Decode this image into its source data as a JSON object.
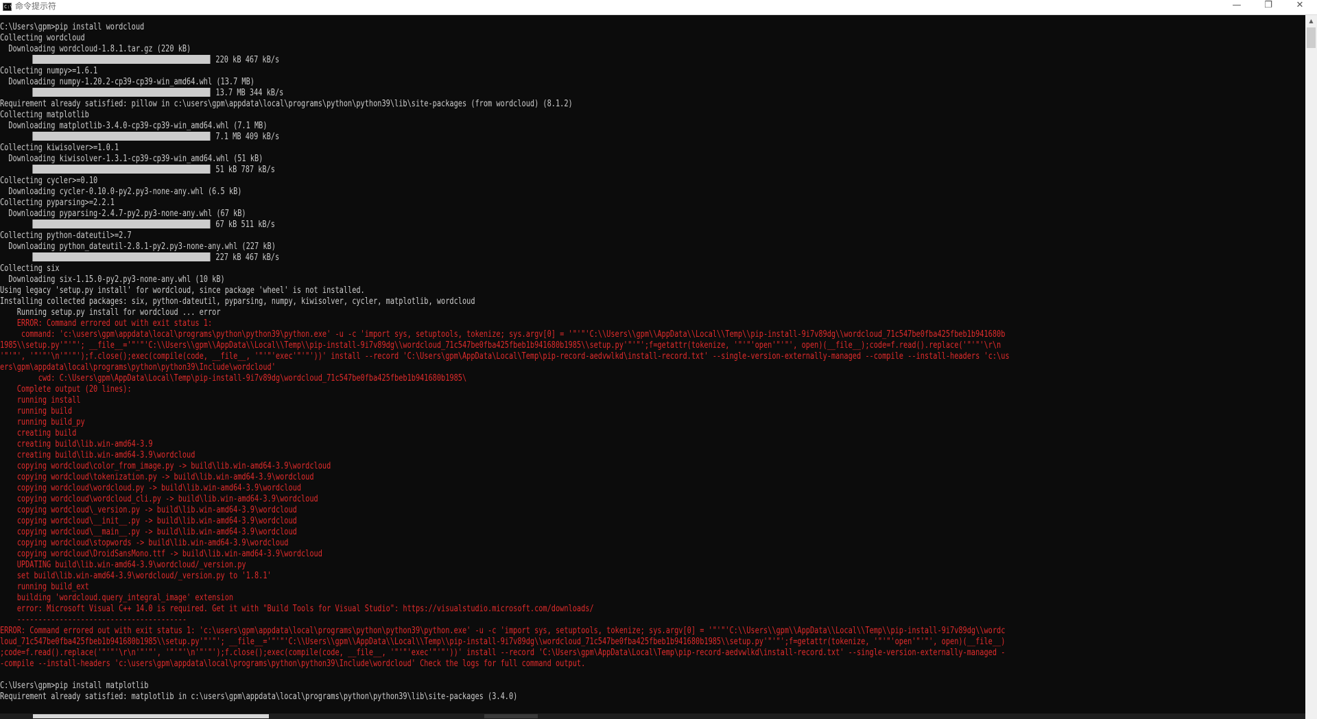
{
  "window": {
    "title": "命令提示符",
    "icon": "cmd-icon",
    "icon_glyph": "C:\\",
    "minimize_glyph": "—",
    "maximize_glyph": "❐",
    "close_glyph": "✕"
  },
  "colors": {
    "background": "#0c0c0c",
    "text": "#cccccc",
    "error": "#e02b2b"
  },
  "scrollbar": {
    "up_glyph": "▲"
  },
  "console": {
    "lines": [
      {
        "text": "C:\\Users\\gpm>pip install wordcloud",
        "style": "gray"
      },
      {
        "text": "Collecting wordcloud",
        "style": "gray"
      },
      {
        "text": "  Downloading wordcloud-1.8.1.tar.gz (220 kB)",
        "style": "gray"
      },
      {
        "text": "220 kB 467 kB/s",
        "style": "gray",
        "progress": 1.0
      },
      {
        "text": "Collecting numpy>=1.6.1",
        "style": "gray"
      },
      {
        "text": "  Downloading numpy-1.20.2-cp39-cp39-win_amd64.whl (13.7 MB)",
        "style": "gray"
      },
      {
        "text": "13.7 MB 344 kB/s",
        "style": "gray",
        "progress": 1.0
      },
      {
        "text": "Requirement already satisfied: pillow in c:\\users\\gpm\\appdata\\local\\programs\\python\\python39\\lib\\site-packages (from wordcloud) (8.1.2)",
        "style": "gray"
      },
      {
        "text": "Collecting matplotlib",
        "style": "gray"
      },
      {
        "text": "  Downloading matplotlib-3.4.0-cp39-cp39-win_amd64.whl (7.1 MB)",
        "style": "gray"
      },
      {
        "text": "7.1 MB 409 kB/s",
        "style": "gray",
        "progress": 1.0
      },
      {
        "text": "Collecting kiwisolver>=1.0.1",
        "style": "gray"
      },
      {
        "text": "  Downloading kiwisolver-1.3.1-cp39-cp39-win_amd64.whl (51 kB)",
        "style": "gray"
      },
      {
        "text": "51 kB 787 kB/s",
        "style": "gray",
        "progress": 1.0
      },
      {
        "text": "Collecting cycler>=0.10",
        "style": "gray"
      },
      {
        "text": "  Downloading cycler-0.10.0-py2.py3-none-any.whl (6.5 kB)",
        "style": "gray"
      },
      {
        "text": "Collecting pyparsing>=2.2.1",
        "style": "gray"
      },
      {
        "text": "  Downloading pyparsing-2.4.7-py2.py3-none-any.whl (67 kB)",
        "style": "gray"
      },
      {
        "text": "67 kB 511 kB/s",
        "style": "gray",
        "progress": 1.0
      },
      {
        "text": "Collecting python-dateutil>=2.7",
        "style": "gray"
      },
      {
        "text": "  Downloading python_dateutil-2.8.1-py2.py3-none-any.whl (227 kB)",
        "style": "gray"
      },
      {
        "text": "227 kB 467 kB/s",
        "style": "gray",
        "progress": 1.0
      },
      {
        "text": "Collecting six",
        "style": "gray"
      },
      {
        "text": "  Downloading six-1.15.0-py2.py3-none-any.whl (10 kB)",
        "style": "gray"
      },
      {
        "text": "Using legacy 'setup.py install' for wordcloud, since package 'wheel' is not installed.",
        "style": "gray"
      },
      {
        "text": "Installing collected packages: six, python-dateutil, pyparsing, numpy, kiwisolver, cycler, matplotlib, wordcloud",
        "style": "gray"
      },
      {
        "text": "    Running setup.py install for wordcloud ... error",
        "style": "gray"
      },
      {
        "text": "    ERROR: Command errored out with exit status 1:",
        "style": "red"
      },
      {
        "text": "     command: 'c:\\users\\gpm\\appdata\\local\\programs\\python\\python39\\python.exe' -u -c 'import sys, setuptools, tokenize; sys.argv[0] = '\"'\"'C:\\\\Users\\\\gpm\\\\AppData\\\\Local\\\\Temp\\\\pip-install-9i7v89dg\\\\wordcloud_71c547be0fba425fbeb1b941680b",
        "style": "red"
      },
      {
        "text": "1985\\\\setup.py'\"'\"'; __file__='\"'\"'C:\\\\Users\\\\gpm\\\\AppData\\\\Local\\\\Temp\\\\pip-install-9i7v89dg\\\\wordcloud_71c547be0fba425fbeb1b941680b1985\\\\setup.py'\"'\"';f=getattr(tokenize, '\"'\"'open'\"'\"', open)(__file__);code=f.read().replace('\"'\"'\\r\\n",
        "style": "red"
      },
      {
        "text": "'\"'\"', '\"'\"'\\n'\"'\"');f.close();exec(compile(code, __file__, '\"'\"'exec'\"'\"'))' install --record 'C:\\Users\\gpm\\AppData\\Local\\Temp\\pip-record-aedvwlkd\\install-record.txt' --single-version-externally-managed --compile --install-headers 'c:\\us",
        "style": "red"
      },
      {
        "text": "ers\\gpm\\appdata\\local\\programs\\python\\python39\\Include\\wordcloud'",
        "style": "red"
      },
      {
        "text": "         cwd: C:\\Users\\gpm\\AppData\\Local\\Temp\\pip-install-9i7v89dg\\wordcloud_71c547be0fba425fbeb1b941680b1985\\",
        "style": "red"
      },
      {
        "text": "    Complete output (20 lines):",
        "style": "red"
      },
      {
        "text": "    running install",
        "style": "red"
      },
      {
        "text": "    running build",
        "style": "red"
      },
      {
        "text": "    running build_py",
        "style": "red"
      },
      {
        "text": "    creating build",
        "style": "red"
      },
      {
        "text": "    creating build\\lib.win-amd64-3.9",
        "style": "red"
      },
      {
        "text": "    creating build\\lib.win-amd64-3.9\\wordcloud",
        "style": "red"
      },
      {
        "text": "    copying wordcloud\\color_from_image.py -> build\\lib.win-amd64-3.9\\wordcloud",
        "style": "red"
      },
      {
        "text": "    copying wordcloud\\tokenization.py -> build\\lib.win-amd64-3.9\\wordcloud",
        "style": "red"
      },
      {
        "text": "    copying wordcloud\\wordcloud.py -> build\\lib.win-amd64-3.9\\wordcloud",
        "style": "red"
      },
      {
        "text": "    copying wordcloud\\wordcloud_cli.py -> build\\lib.win-amd64-3.9\\wordcloud",
        "style": "red"
      },
      {
        "text": "    copying wordcloud\\_version.py -> build\\lib.win-amd64-3.9\\wordcloud",
        "style": "red"
      },
      {
        "text": "    copying wordcloud\\__init__.py -> build\\lib.win-amd64-3.9\\wordcloud",
        "style": "red"
      },
      {
        "text": "    copying wordcloud\\__main__.py -> build\\lib.win-amd64-3.9\\wordcloud",
        "style": "red"
      },
      {
        "text": "    copying wordcloud\\stopwords -> build\\lib.win-amd64-3.9\\wordcloud",
        "style": "red"
      },
      {
        "text": "    copying wordcloud\\DroidSansMono.ttf -> build\\lib.win-amd64-3.9\\wordcloud",
        "style": "red"
      },
      {
        "text": "    UPDATING build\\lib.win-amd64-3.9\\wordcloud/_version.py",
        "style": "red"
      },
      {
        "text": "    set build\\lib.win-amd64-3.9\\wordcloud/_version.py to '1.8.1'",
        "style": "red"
      },
      {
        "text": "    running build_ext",
        "style": "red"
      },
      {
        "text": "    building 'wordcloud.query_integral_image' extension",
        "style": "red"
      },
      {
        "text": "    error: Microsoft Visual C++ 14.0 is required. Get it with \"Build Tools for Visual Studio\": https://visualstudio.microsoft.com/downloads/",
        "style": "red"
      },
      {
        "text": "    ----------------------------------------",
        "style": "red"
      },
      {
        "text": "ERROR: Command errored out with exit status 1: 'c:\\users\\gpm\\appdata\\local\\programs\\python\\python39\\python.exe' -u -c 'import sys, setuptools, tokenize; sys.argv[0] = '\"'\"'C:\\\\Users\\\\gpm\\\\AppData\\\\Local\\\\Temp\\\\pip-install-9i7v89dg\\\\wordc",
        "style": "red"
      },
      {
        "text": "loud_71c547be0fba425fbeb1b941680b1985\\\\setup.py'\"'\"'; __file__='\"'\"'C:\\\\Users\\\\gpm\\\\AppData\\\\Local\\\\Temp\\\\pip-install-9i7v89dg\\\\wordcloud_71c547be0fba425fbeb1b941680b1985\\\\setup.py'\"'\"';f=getattr(tokenize, '\"'\"'open'\"'\"', open)(__file__)",
        "style": "red"
      },
      {
        "text": ";code=f.read().replace('\"'\"'\\r\\n'\"'\"', '\"'\"'\\n'\"'\"');f.close();exec(compile(code, __file__, '\"'\"'exec'\"'\"'))' install --record 'C:\\Users\\gpm\\AppData\\Local\\Temp\\pip-record-aedvwlkd\\install-record.txt' --single-version-externally-managed -",
        "style": "red"
      },
      {
        "text": "-compile --install-headers 'c:\\users\\gpm\\appdata\\local\\programs\\python\\python39\\Include\\wordcloud' Check the logs for full command output.",
        "style": "red"
      },
      {
        "text": "",
        "style": "gray"
      },
      {
        "text": "C:\\Users\\gpm>pip install matplotlib",
        "style": "gray"
      },
      {
        "text": "Requirement already satisfied: matplotlib in c:\\users\\gpm\\appdata\\local\\programs\\python\\python39\\lib\\site-packages (3.4.0)",
        "style": "gray"
      }
    ]
  }
}
